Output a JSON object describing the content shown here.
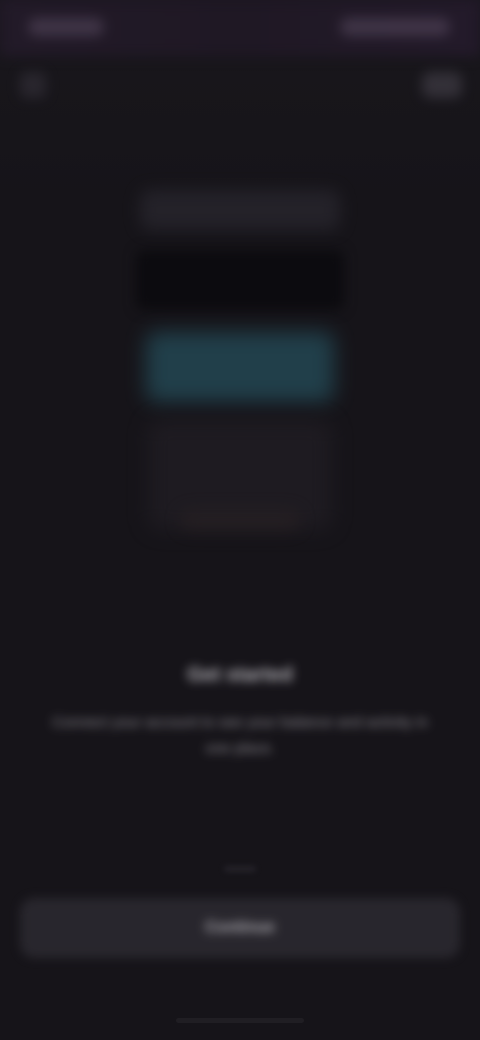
{
  "screen": {
    "title": "Get started",
    "description": "Connect your account to see your balance and activity in one place.",
    "primary_button_label": "Continue"
  },
  "icons": {
    "back": "back-arrow-icon",
    "action": "top-right-action"
  },
  "colors": {
    "background": "#161419",
    "preview_accent": "#234753",
    "button": "#2c2a31"
  }
}
